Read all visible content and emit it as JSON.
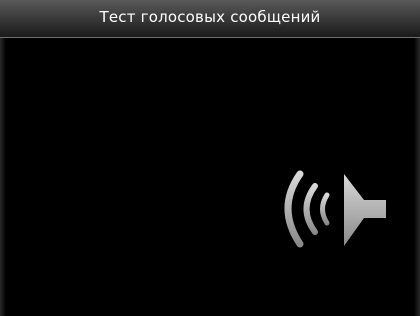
{
  "window": {
    "title": "Тест голосовых сообщений"
  },
  "main": {
    "icon": "speaker-sound-icon"
  },
  "colors": {
    "background": "#000000",
    "title_text": "#ffffff",
    "icon_grey": "#bdbdbd"
  }
}
